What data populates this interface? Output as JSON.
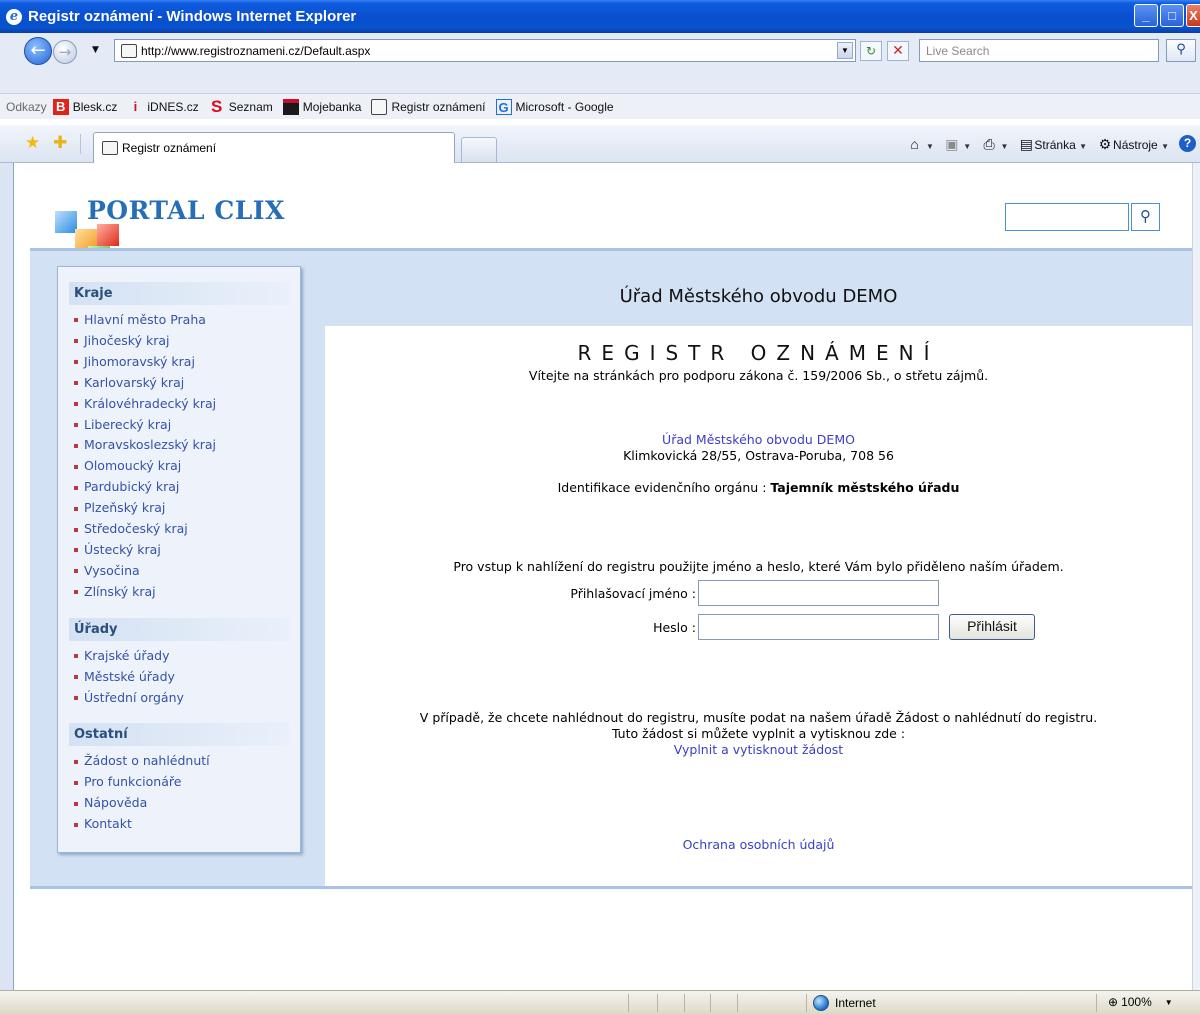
{
  "window": {
    "title": "Registr oznámení - Windows Internet Explorer",
    "url": "http://www.registroznameni.cz/Default.aspx",
    "search_placeholder": "Live Search",
    "links_label": "Odkazy",
    "links": [
      {
        "label": "Blesk.cz",
        "icon": "blesk-icon",
        "color": "#e2231a",
        "glyph": "B"
      },
      {
        "label": "iDNES.cz",
        "icon": "idnes-icon",
        "color": "#d10f1f",
        "glyph": "i"
      },
      {
        "label": "Seznam",
        "icon": "seznam-icon",
        "color": "#d80c18",
        "glyph": "S"
      },
      {
        "label": "Mojebanka",
        "icon": "mojebanka-icon",
        "color": "#c8102e",
        "glyph": "▬"
      },
      {
        "label": "Registr oznámení",
        "icon": "page-icon",
        "color": "#333333",
        "glyph": "▭"
      },
      {
        "label": "Microsoft - Google",
        "icon": "google-icon",
        "color": "#1f6fd6",
        "glyph": "G"
      }
    ],
    "tab_label": "Registr oznámení",
    "cmd": {
      "page": "Stránka",
      "tools": "Nástroje"
    },
    "status": {
      "zone": "Internet",
      "zoom": "100%"
    }
  },
  "header": {
    "logo_text": "PORTAL CLIX"
  },
  "sidebar": {
    "sections": [
      {
        "title": "Kraje",
        "items": [
          "Hlavní město Praha",
          "Jihočeský kraj",
          "Jihomoravský kraj",
          "Karlovarský kraj",
          "Královéhradecký kraj",
          "Liberecký kraj",
          "Moravskoslezský kraj",
          "Olomoucký kraj",
          "Pardubický kraj",
          "Plzeňský kraj",
          "Středočeský kraj",
          "Ústecký kraj",
          "Vysočina",
          "Zlínský kraj"
        ]
      },
      {
        "title": "Úřady",
        "items": [
          "Krajské úřady",
          "Městské úřady",
          "Ústřední orgány"
        ]
      },
      {
        "title": "Ostatní",
        "items": [
          "Žádost o nahlédnutí",
          "Pro funkcionáře",
          "Nápověda",
          "Kontakt"
        ]
      }
    ]
  },
  "main": {
    "office_title": "Úřad Městského obvodu DEMO",
    "registry_title": "REGISTR OZNÁMENÍ",
    "welcome": "Vítejte na stránkách pro podporu zákona č. 159/2006 Sb., o střetu zájmů.",
    "office_link": "Úřad Městského obvodu DEMO",
    "address": "Klimkovická 28/55, Ostrava-Poruba, 708 56",
    "ident_label": "Identifikace evidenčního orgánu : ",
    "ident_value": "Tajemník městského úřadu",
    "login_info": "Pro vstup k nahlížení do registru použijte jméno a heslo, které Vám bylo přiděleno naším úřadem.",
    "username_label": "Přihlašovací jméno :",
    "password_label": "Heslo :",
    "login_button": "Přihlásit",
    "note_line1": "V případě, že chcete nahlédnout do registru, musíte podat na našem úřadě Žádost o nahlédnutí do registru.",
    "note_line2": "Tuto žádost si můžete vyplnit a vytisknou zde :",
    "fill_link": "Vyplnit a vytisknout žádost",
    "privacy_link": "Ochrana osobních údajů"
  }
}
